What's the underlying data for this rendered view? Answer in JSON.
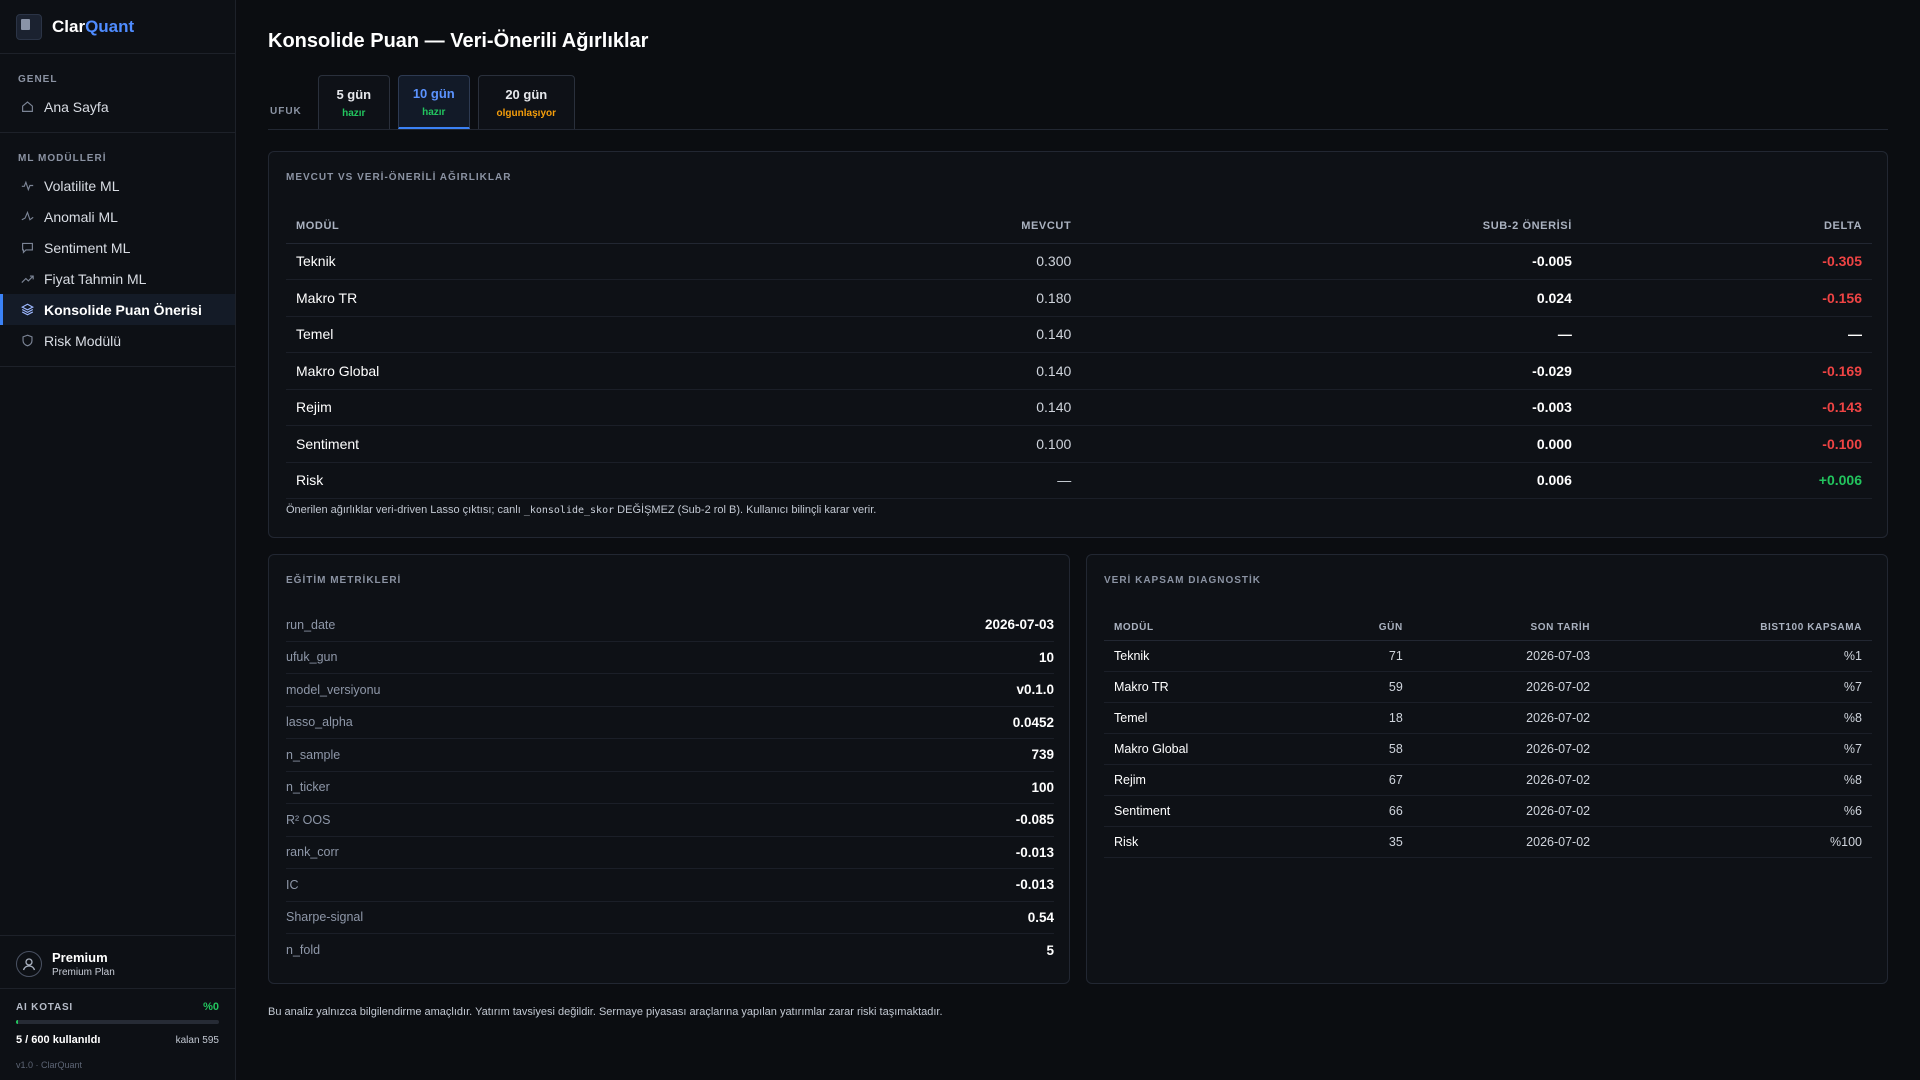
{
  "brand": {
    "name_part1": "Clar",
    "name_part2": "Quant"
  },
  "sidebar": {
    "sections": [
      {
        "title": "GENEL",
        "items": [
          {
            "label": "Ana Sayfa",
            "icon": "home-icon"
          }
        ]
      },
      {
        "title": "ML MODÜLLERİ",
        "items": [
          {
            "label": "Volatilite ML",
            "icon": "activity-icon"
          },
          {
            "label": "Anomali ML",
            "icon": "pulse-icon"
          },
          {
            "label": "Sentiment ML",
            "icon": "message-icon"
          },
          {
            "label": "Fiyat Tahmin ML",
            "icon": "trend-icon"
          },
          {
            "label": "Konsolide Puan Önerisi",
            "icon": "layers-icon",
            "active": true
          },
          {
            "label": "Risk Modülü",
            "icon": "shield-icon"
          }
        ]
      }
    ],
    "profile": {
      "name": "Premium",
      "plan": "Premium Plan"
    },
    "quota": {
      "title": "AI KOTASI",
      "percent_label": "%0",
      "fill_fraction": 0.008,
      "used": "5 / 600 kullanıldı",
      "remaining": "kalan 595"
    },
    "version": "v1.0 · ClarQuant"
  },
  "page": {
    "title": "Konsolide Puan — Veri-Önerili Ağırlıklar"
  },
  "horizon": {
    "label": "UFUK",
    "tabs": [
      {
        "label": "5 gün",
        "status": "hazır",
        "state": "ready"
      },
      {
        "label": "10 gün",
        "status": "hazır",
        "state": "ready",
        "active": true
      },
      {
        "label": "20 gün",
        "status": "olgunlaşıyor",
        "state": "pending"
      }
    ]
  },
  "weights": {
    "title": "MEVCUT VS VERİ-ÖNERİLİ AĞIRLIKLAR",
    "columns": [
      "MODÜL",
      "MEVCUT",
      "SUB-2 ÖNERİSİ",
      "DELTA"
    ],
    "rows": [
      {
        "module": "Teknik",
        "current": "0.300",
        "suggested": "-0.005",
        "delta": "-0.305",
        "sign": "neg"
      },
      {
        "module": "Makro TR",
        "current": "0.180",
        "suggested": "0.024",
        "delta": "-0.156",
        "sign": "neg"
      },
      {
        "module": "Temel",
        "current": "0.140",
        "suggested": "—",
        "delta": "—",
        "sign": "none"
      },
      {
        "module": "Makro Global",
        "current": "0.140",
        "suggested": "-0.029",
        "delta": "-0.169",
        "sign": "neg"
      },
      {
        "module": "Rejim",
        "current": "0.140",
        "suggested": "-0.003",
        "delta": "-0.143",
        "sign": "neg"
      },
      {
        "module": "Sentiment",
        "current": "0.100",
        "suggested": "0.000",
        "delta": "-0.100",
        "sign": "neg"
      },
      {
        "module": "Risk",
        "current": "—",
        "suggested": "0.006",
        "delta": "+0.006",
        "sign": "pos"
      }
    ],
    "note_before": "Önerilen ağırlıklar veri-driven Lasso çıktısı; canlı ",
    "note_code": "_konsolide_skor",
    "note_after": " DEĞİŞMEZ (Sub-2 rol B). Kullanıcı bilinçli karar verir."
  },
  "metrics": {
    "title": "EĞİTİM METRİKLERİ",
    "rows": [
      {
        "key": "run_date",
        "value": "2026-07-03"
      },
      {
        "key": "ufuk_gun",
        "value": "10"
      },
      {
        "key": "model_versiyonu",
        "value": "v0.1.0"
      },
      {
        "key": "lasso_alpha",
        "value": "0.0452"
      },
      {
        "key": "n_sample",
        "value": "739"
      },
      {
        "key": "n_ticker",
        "value": "100"
      },
      {
        "key": "R² OOS",
        "value": "-0.085"
      },
      {
        "key": "rank_corr",
        "value": "-0.013"
      },
      {
        "key": "IC",
        "value": "-0.013"
      },
      {
        "key": "Sharpe-signal",
        "value": "0.54"
      },
      {
        "key": "n_fold",
        "value": "5"
      }
    ]
  },
  "coverage": {
    "title": "VERİ KAPSAM DIAGNOSTİK",
    "columns": [
      "MODÜL",
      "GÜN",
      "SON TARİH",
      "BIST100 KAPSAMA"
    ],
    "rows": [
      {
        "module": "Teknik",
        "days": "71",
        "last_date": "2026-07-03",
        "coverage": "%1"
      },
      {
        "module": "Makro TR",
        "days": "59",
        "last_date": "2026-07-02",
        "coverage": "%7"
      },
      {
        "module": "Temel",
        "days": "18",
        "last_date": "2026-07-02",
        "coverage": "%8"
      },
      {
        "module": "Makro Global",
        "days": "58",
        "last_date": "2026-07-02",
        "coverage": "%7"
      },
      {
        "module": "Rejim",
        "days": "67",
        "last_date": "2026-07-02",
        "coverage": "%8"
      },
      {
        "module": "Sentiment",
        "days": "66",
        "last_date": "2026-07-02",
        "coverage": "%6"
      },
      {
        "module": "Risk",
        "days": "35",
        "last_date": "2026-07-02",
        "coverage": "%100"
      }
    ]
  },
  "disclaimer": "Bu analiz yalnızca bilgilendirme amaçlıdır. Yatırım tavsiyesi değildir. Sermaye piyasası araçlarına yapılan yatırımlar zarar riski taşımaktadır."
}
